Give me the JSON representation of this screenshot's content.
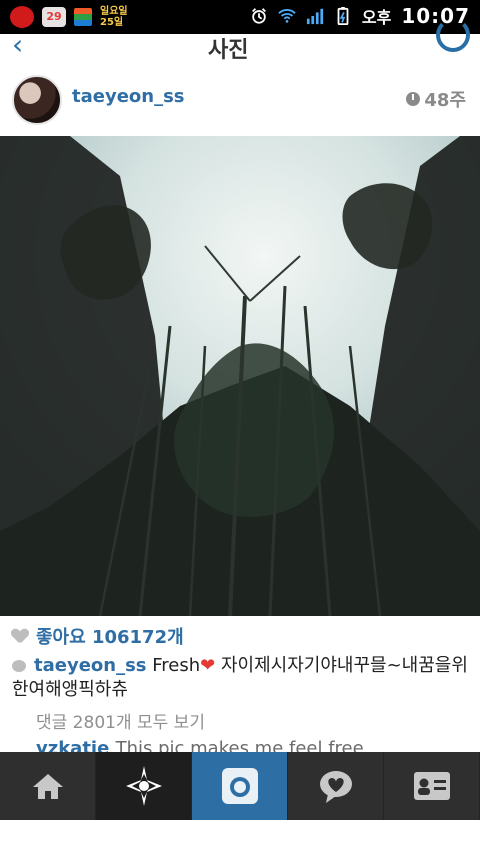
{
  "status_bar": {
    "calendar_date": "29",
    "day_label_top": "일요일",
    "day_label_bottom": "25일",
    "ampm": "오후",
    "time": "10:07"
  },
  "header": {
    "title": "사진"
  },
  "post": {
    "username": "taeyeon_ss",
    "age": "48주",
    "likes_text": "좋아요 106172개",
    "caption_user": "taeyeon_ss",
    "caption_text": "Fresh",
    "caption_heart": "❤",
    "caption_more": " 자이제시자기야내꾸믈~내꿈을위한여해앵픽하츄",
    "view_comments": "댓글 2801개 모두 보기",
    "next_comment_user": "vzkatie",
    "next_comment_text": "This pic makes me feel free"
  },
  "tabbar": {
    "items": [
      {
        "icon": "home-icon"
      },
      {
        "icon": "explore-icon"
      },
      {
        "icon": "camera-icon"
      },
      {
        "icon": "activity-icon"
      },
      {
        "icon": "profile-icon"
      }
    ],
    "active_index": 2
  },
  "colors": {
    "accent": "#2f6ea5",
    "tab_active": "#2d6fa4",
    "tabbar_bg": "#2f2f2f"
  }
}
